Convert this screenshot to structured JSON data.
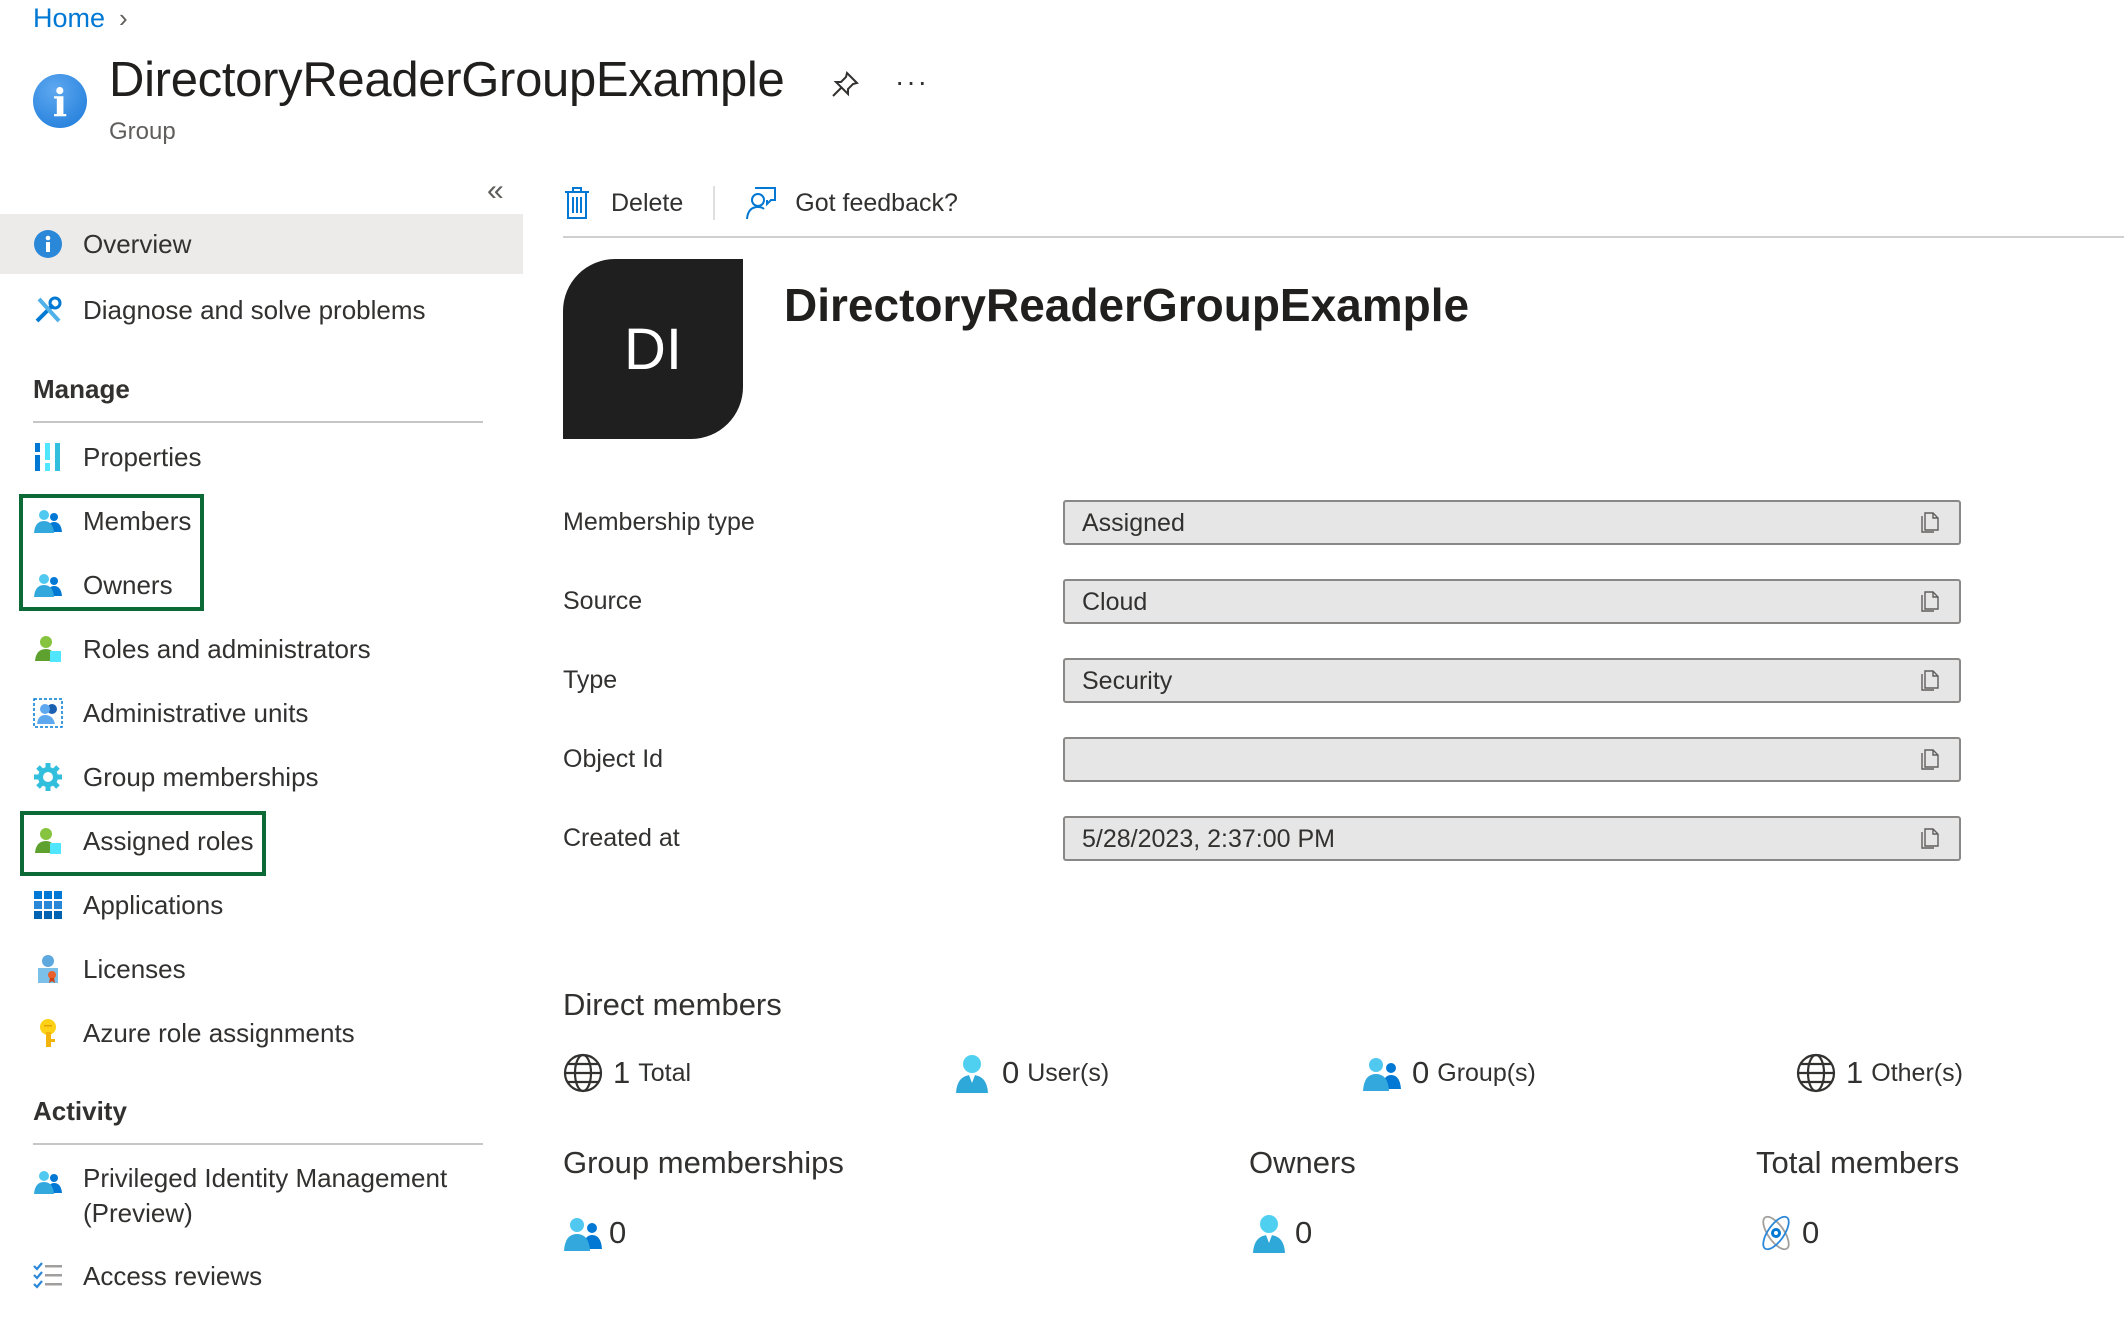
{
  "breadcrumb": {
    "items": [
      "Home"
    ],
    "separator": ">"
  },
  "header": {
    "title": "DirectoryReaderGroupExample",
    "subtitle": "Group",
    "icon": "info-icon",
    "pin_icon": "pin-icon",
    "more_label": "···"
  },
  "sidebar": {
    "collapse_label": "«",
    "items": [
      {
        "label": "Overview",
        "icon": "info-icon",
        "active": true
      },
      {
        "label": "Diagnose and solve problems",
        "icon": "wrench-icon"
      }
    ],
    "sections": [
      {
        "title": "Manage",
        "items": [
          {
            "label": "Properties",
            "icon": "properties-icon"
          },
          {
            "label": "Members",
            "icon": "group-icon",
            "highlighted": true
          },
          {
            "label": "Owners",
            "icon": "group-icon",
            "highlighted": true
          },
          {
            "label": "Roles and administrators",
            "icon": "role-user-icon"
          },
          {
            "label": "Administrative units",
            "icon": "admin-units-icon"
          },
          {
            "label": "Group memberships",
            "icon": "gear-icon"
          },
          {
            "label": "Assigned roles",
            "icon": "role-user-icon",
            "highlighted": true
          },
          {
            "label": "Applications",
            "icon": "apps-grid-icon"
          },
          {
            "label": "Licenses",
            "icon": "license-icon"
          },
          {
            "label": "Azure role assignments",
            "icon": "key-icon"
          }
        ]
      },
      {
        "title": "Activity",
        "items": [
          {
            "label": "Privileged Identity Management",
            "label_line2": "(Preview)",
            "icon": "group-icon"
          },
          {
            "label": "Access reviews",
            "icon": "checklist-icon"
          }
        ]
      }
    ]
  },
  "toolbar": {
    "delete_label": "Delete",
    "feedback_label": "Got feedback?"
  },
  "overview": {
    "avatar_initials": "DI",
    "title": "DirectoryReaderGroupExample",
    "fields": [
      {
        "label": "Membership type",
        "value": "Assigned"
      },
      {
        "label": "Source",
        "value": "Cloud"
      },
      {
        "label": "Type",
        "value": "Security"
      },
      {
        "label": "Object Id",
        "value": ""
      },
      {
        "label": "Created at",
        "value": "5/28/2023, 2:37:00 PM"
      }
    ],
    "direct_members": {
      "heading": "Direct members",
      "stats": [
        {
          "count": "1",
          "label": "Total",
          "icon": "globe-icon"
        },
        {
          "count": "0",
          "label": "User(s)",
          "icon": "user-icon"
        },
        {
          "count": "0",
          "label": "Group(s)",
          "icon": "group-icon"
        },
        {
          "count": "1",
          "label": "Other(s)",
          "icon": "globe-icon"
        }
      ]
    },
    "summary": [
      {
        "heading": "Group memberships",
        "value": "0",
        "icon": "group-icon"
      },
      {
        "heading": "Owners",
        "value": "0",
        "icon": "user-icon"
      },
      {
        "heading": "Total members",
        "value": "0",
        "icon": "atom-icon"
      }
    ]
  },
  "colors": {
    "accent": "#0078d4",
    "highlight_border": "#0b6a36",
    "active_nav_bg": "#edebe9",
    "avatar_bg": "#201f1f",
    "field_bg": "#e6e6e6"
  }
}
